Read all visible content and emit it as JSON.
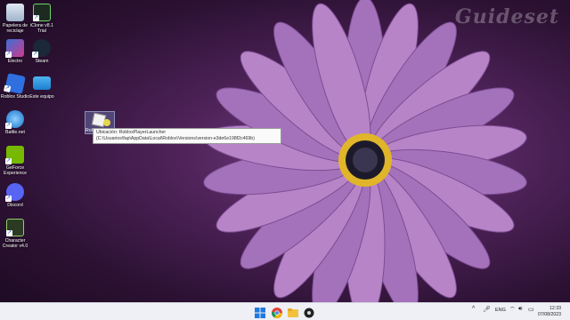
{
  "watermark": "Guideset",
  "desktop_icons": [
    {
      "name": "recycle-bin",
      "label": "Papelera de reciclaje"
    },
    {
      "name": "iclone",
      "label": "iClone v8.1 Trial"
    },
    {
      "name": "electro",
      "label": "Electro"
    },
    {
      "name": "steam",
      "label": "Steam"
    },
    {
      "name": "roblox-studio",
      "label": "Roblox Studio"
    },
    {
      "name": "este-equipo",
      "label": "Este equipo"
    },
    {
      "name": "battlenet",
      "label": "Battle.net"
    },
    {
      "name": "geforce",
      "label": "GeForce Experience"
    },
    {
      "name": "discord",
      "label": "Discord"
    },
    {
      "name": "character-creator",
      "label": "Character Creator v4.0"
    }
  ],
  "drag_label": "Rob",
  "tooltip": {
    "text": "Ubicación: RobloxPlayerLauncher (C:\\Usuarios\\fap\\AppData\\Local\\Roblox\\Versions\\version-e3de6e198f2c469b)"
  },
  "tray": {
    "language": "ENG",
    "time": "12:33",
    "date": "07/08/2023"
  }
}
